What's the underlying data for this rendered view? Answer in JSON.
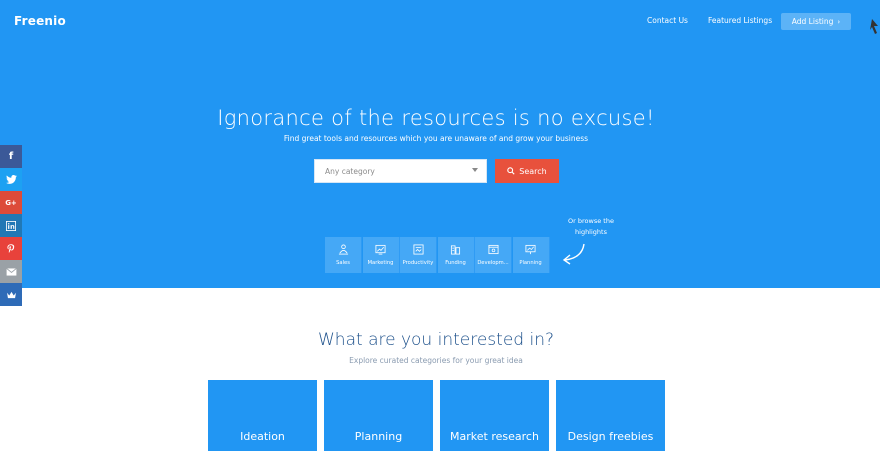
{
  "colors": {
    "hero_bg": "#2196f3",
    "search_button": "#e8513c",
    "add_button": "#5cb3f7",
    "section_title": "#1b4f8a"
  },
  "nav": {
    "logo": "Freenio",
    "contact": "Contact Us",
    "featured": "Featured Listings",
    "add_listing": "Add Listing",
    "add_listing_icon": "chevron-right-icon"
  },
  "hero": {
    "title": "Ignorance of the resources is no excuse!",
    "subtitle": "Find great tools and resources which you are unaware of and grow your business",
    "category_select": "Any category",
    "search_label": "Search",
    "browse_text": "Or browse the highlights"
  },
  "highlights": [
    {
      "label": "Sales",
      "icon": "user-group-icon"
    },
    {
      "label": "Marketing",
      "icon": "chart-up-icon"
    },
    {
      "label": "Productivity",
      "icon": "clipboard-icon"
    },
    {
      "label": "Funding",
      "icon": "building-icon"
    },
    {
      "label": "Developm...",
      "icon": "code-window-icon"
    },
    {
      "label": "Planning",
      "icon": "whiteboard-icon"
    }
  ],
  "social": [
    "facebook-icon",
    "twitter-icon",
    "google-plus-icon",
    "linkedin-icon",
    "pinterest-icon",
    "email-icon",
    "crown-icon"
  ],
  "interests": {
    "title": "What are you interested in?",
    "subtitle": "Explore curated categories for your great idea",
    "tiles": [
      "Ideation",
      "Planning",
      "Market research",
      "Design freebies"
    ]
  }
}
